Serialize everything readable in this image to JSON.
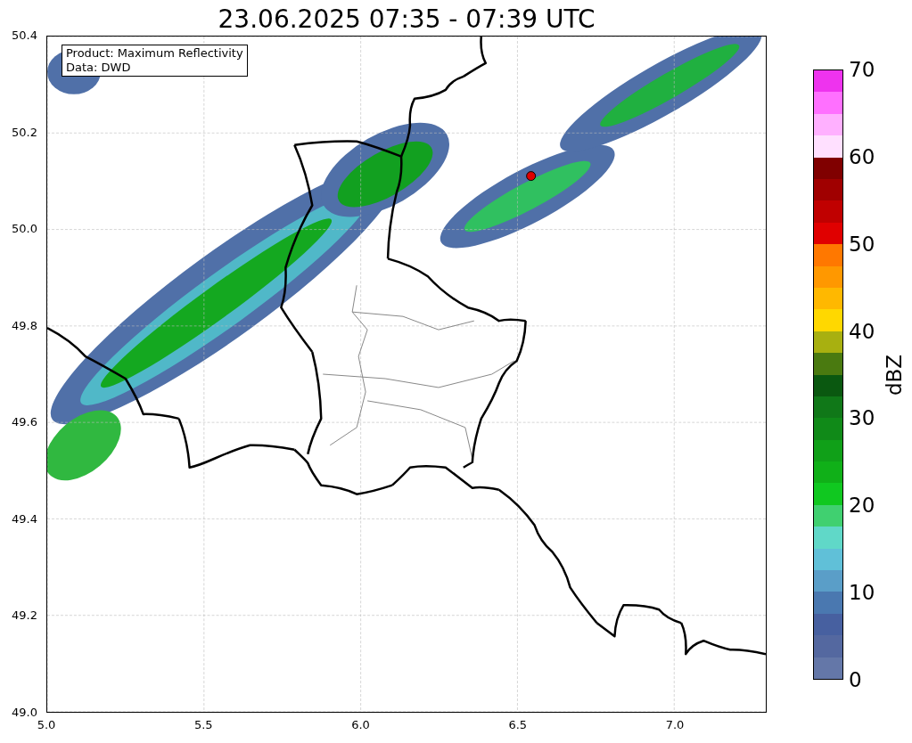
{
  "title": "23.06.2025 07:35 - 07:39 UTC",
  "legend": [
    "Product: Maximum Reflectivity",
    "Data: DWD"
  ],
  "map": {
    "xticks": [
      "5.0",
      "5.5",
      "6.0",
      "6.5",
      "7.0"
    ],
    "yticks": [
      "50.4",
      "50.2",
      "50.0",
      "49.8",
      "49.6",
      "49.4",
      "49.2",
      "49.0"
    ]
  },
  "colorbar": {
    "label": "dBZ",
    "ticks": [
      "70",
      "60",
      "50",
      "40",
      "30",
      "20",
      "10",
      "0"
    ],
    "bands": [
      {
        "color": "#6477a8"
      },
      {
        "color": "#5468a0"
      },
      {
        "color": "#4760a0"
      },
      {
        "color": "#4a78b0"
      },
      {
        "color": "#5a9ec8"
      },
      {
        "color": "#60c0d8"
      },
      {
        "color": "#60d8c8"
      },
      {
        "color": "#40d070"
      },
      {
        "color": "#10c820"
      },
      {
        "color": "#10b018"
      },
      {
        "color": "#10a018"
      },
      {
        "color": "#108a18"
      },
      {
        "color": "#107818"
      },
      {
        "color": "#0a5810"
      },
      {
        "color": "#4a7a10"
      },
      {
        "color": "#a8b010"
      },
      {
        "color": "#ffd800"
      },
      {
        "color": "#ffb800"
      },
      {
        "color": "#ff9800"
      },
      {
        "color": "#ff7800"
      },
      {
        "color": "#e00000"
      },
      {
        "color": "#c00000"
      },
      {
        "color": "#a00000"
      },
      {
        "color": "#800000"
      },
      {
        "color": "#ffe0ff"
      },
      {
        "color": "#ffb0ff"
      },
      {
        "color": "#ff70ff"
      },
      {
        "color": "#ee33ee"
      }
    ]
  }
}
